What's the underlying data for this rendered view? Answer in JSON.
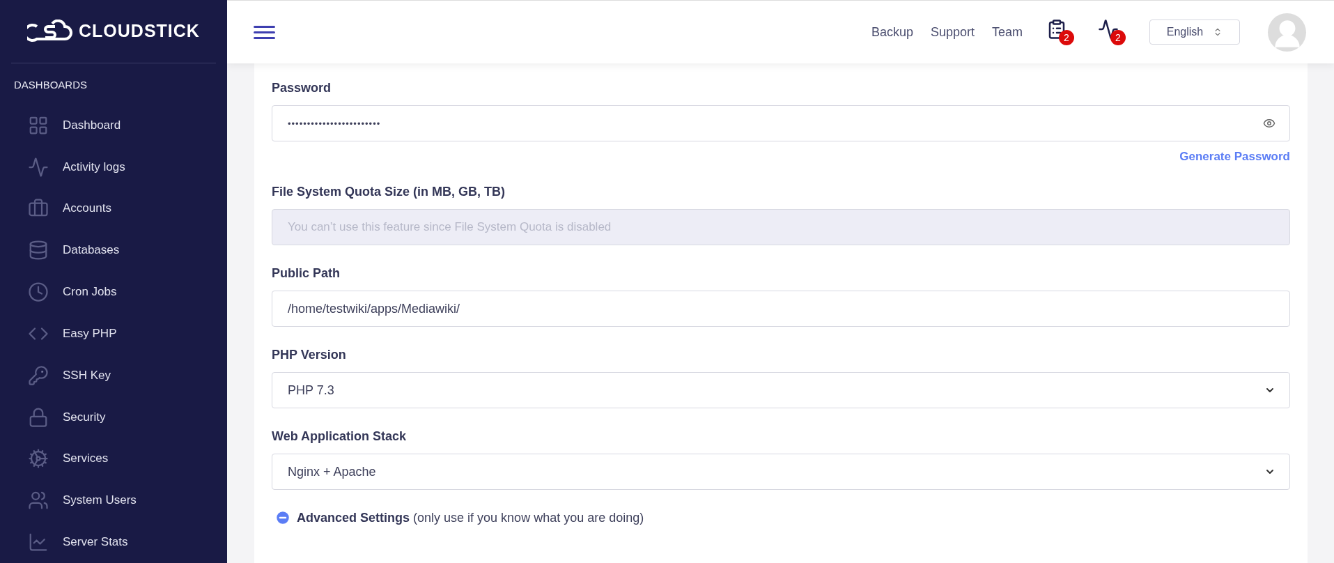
{
  "sidebar": {
    "logo": "CLOUDSTICK",
    "section": "DASHBOARDS",
    "items": [
      {
        "label": "Dashboard"
      },
      {
        "label": "Activity logs"
      },
      {
        "label": "Accounts"
      },
      {
        "label": "Databases"
      },
      {
        "label": "Cron Jobs"
      },
      {
        "label": "Easy PHP"
      },
      {
        "label": "SSH Key"
      },
      {
        "label": "Security"
      },
      {
        "label": "Services"
      },
      {
        "label": "System Users"
      },
      {
        "label": "Server Stats"
      }
    ]
  },
  "header": {
    "links": [
      "Backup",
      "Support",
      "Team"
    ],
    "tasks_badge": "2",
    "activity_badge": "2",
    "language": "English"
  },
  "form": {
    "fields": [
      {
        "kind": "password",
        "label": "Password",
        "value": "••••••••••••••••••••••••",
        "action": "Generate Password"
      },
      {
        "kind": "disabled",
        "label": "File System Quota Size (in MB, GB, TB)",
        "placeholder": "You can’t use this feature since File System Quota is disabled"
      },
      {
        "kind": "text",
        "label": "Public Path",
        "value": "/home/testwiki/apps/Mediawiki/"
      },
      {
        "kind": "select",
        "label": "PHP Version",
        "value": "PHP 7.3"
      },
      {
        "kind": "select",
        "label": "Web Application Stack",
        "value": "Nginx + Apache"
      }
    ],
    "advanced": {
      "expanded": true,
      "text": "**Advanced Settings** (only use if you know what you are doing)"
    }
  }
}
